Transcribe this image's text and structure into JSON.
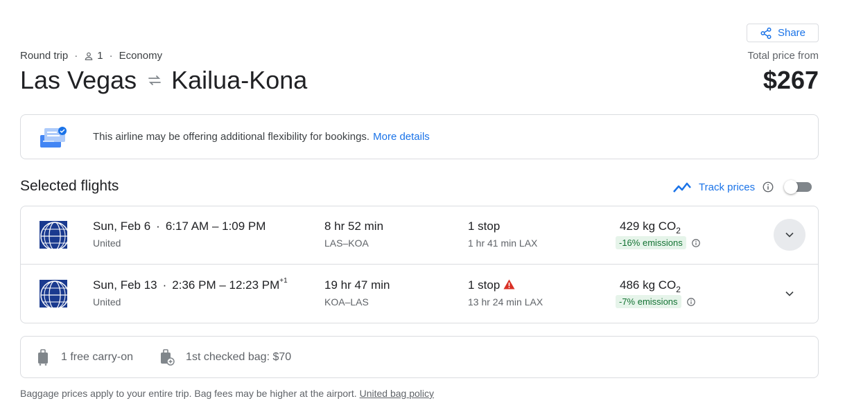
{
  "share": {
    "label": "Share",
    "icon": "share-icon"
  },
  "trip": {
    "type": "Round trip",
    "passengers": "1",
    "cabin": "Economy",
    "origin": "Las Vegas",
    "destination": "Kailua-Kona"
  },
  "price": {
    "label": "Total price from",
    "value": "$267"
  },
  "banner": {
    "text": "This airline may be offering additional flexibility for bookings.",
    "link": "More details"
  },
  "selected": {
    "title": "Selected flights",
    "track_label": "Track prices",
    "track_enabled": false
  },
  "flights": [
    {
      "date": "Sun, Feb 6",
      "times": "6:17 AM – 1:09 PM",
      "day_offset": "",
      "airline": "United",
      "duration": "8 hr 52 min",
      "route": "LAS–KOA",
      "stops": "1 stop",
      "layover": "1 hr 41 min LAX",
      "co2": "429 kg CO",
      "co2_sub": "2",
      "emissions": "-16% emissions",
      "warning": false
    },
    {
      "date": "Sun, Feb 13",
      "times": "2:36 PM – 12:23 PM",
      "day_offset": "+1",
      "airline": "United",
      "duration": "19 hr 47 min",
      "route": "KOA–LAS",
      "stops": "1 stop",
      "layover": "13 hr 24 min LAX",
      "co2": "486 kg CO",
      "co2_sub": "2",
      "emissions": "-7% emissions",
      "warning": true
    }
  ],
  "bags": {
    "carry_on": "1 free carry-on",
    "checked": "1st checked bag: $70"
  },
  "note": {
    "text": "Baggage prices apply to your entire trip. Bag fees may be higher at the airport.",
    "link": "United bag policy"
  },
  "colors": {
    "accent": "#1a73e8",
    "emissions_bg": "#e6f4ea",
    "emissions_text": "#137333",
    "warning": "#d93025",
    "united_blue": "#1a3a8f"
  }
}
